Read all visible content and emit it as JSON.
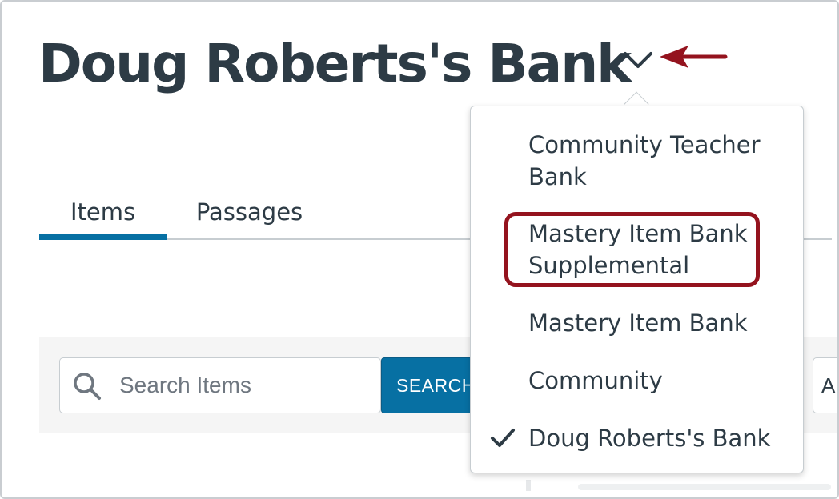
{
  "header": {
    "bank_title": "Doug Roberts's Bank",
    "dropdown_icon": "chevron-down-icon"
  },
  "tabs": [
    {
      "label": "Items",
      "active": true
    },
    {
      "label": "Passages",
      "active": false
    }
  ],
  "toolbar": {
    "search_placeholder": "Search Items",
    "search_value": "",
    "search_button_label": "SEARCH",
    "filter_visible_text": "A"
  },
  "bank_menu": {
    "items": [
      {
        "label": "Community Teacher Bank",
        "selected": false
      },
      {
        "label": "Mastery Item Bank Supplemental",
        "selected": false,
        "highlighted": true
      },
      {
        "label": "Mastery Item Bank",
        "selected": false
      },
      {
        "label": "Community",
        "selected": false
      },
      {
        "label": "Doug Roberts's Bank",
        "selected": true
      }
    ]
  },
  "colors": {
    "text": "#2d3b45",
    "accent_blue": "#0770a3",
    "annotation_red": "#94131e",
    "toolbar_bg": "#f5f5f5"
  }
}
